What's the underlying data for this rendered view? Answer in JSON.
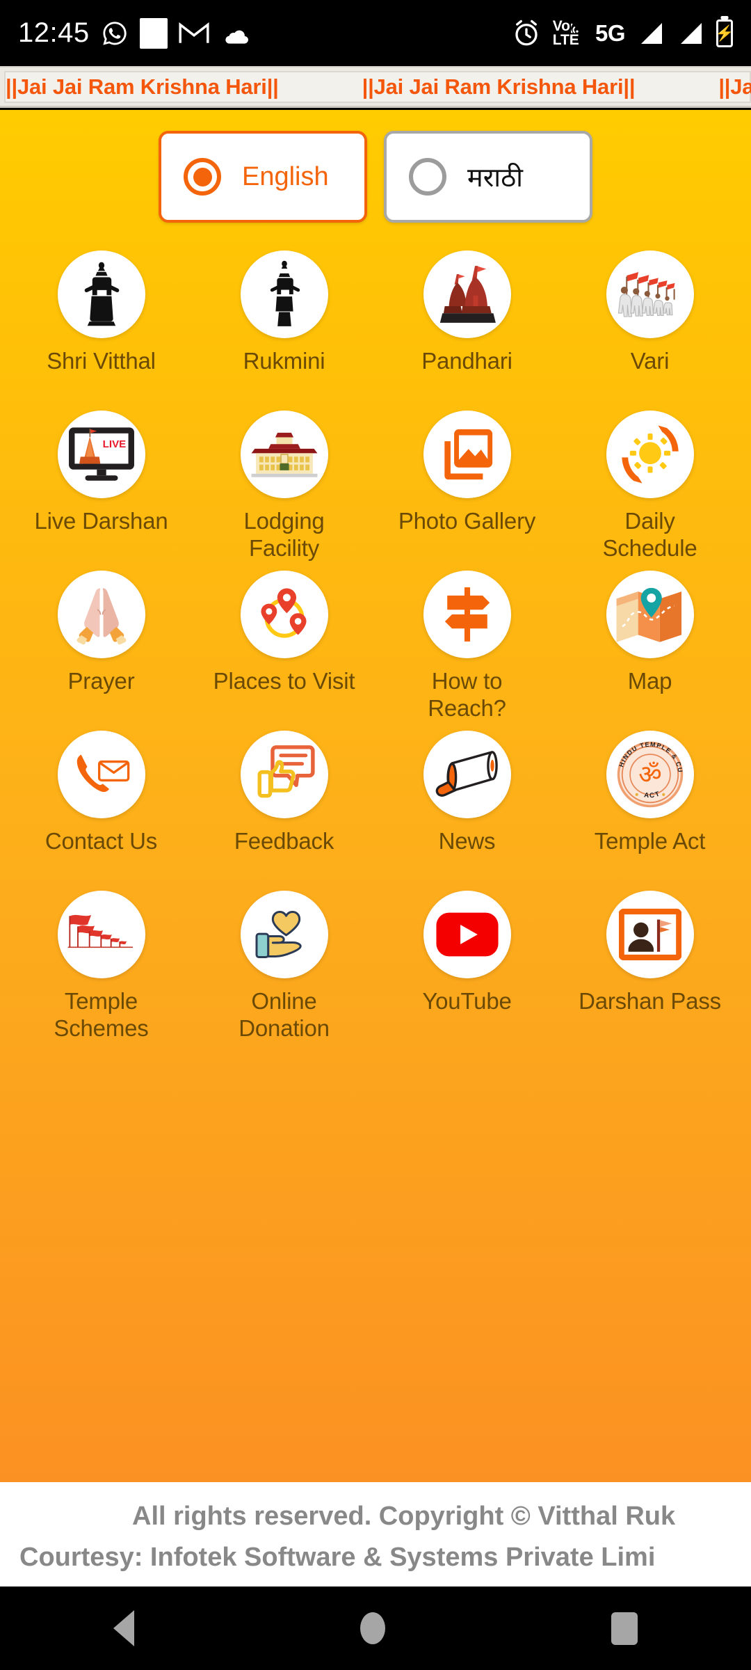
{
  "statusbar": {
    "time": "12:45",
    "left_icons": [
      "whatsapp-icon",
      "white-square-icon",
      "gmail-icon",
      "cloud-icon"
    ],
    "right_icons": [
      "alarm-icon",
      "volte-icon",
      "5g-icon",
      "signal-icon",
      "signal-icon",
      "battery-charging-icon"
    ],
    "volte_top": "Vo",
    "volte_bottom": "LTE",
    "network": "5G"
  },
  "marquee": {
    "text": "||Jai Jai Ram Krishna Hari||",
    "repeats": 4,
    "color": "#f4560c"
  },
  "language": {
    "selected": "English",
    "options": [
      {
        "label": "English",
        "selected": true
      },
      {
        "label": "मराठी",
        "selected": false
      }
    ]
  },
  "grid": {
    "items": [
      {
        "label": "Shri Vitthal",
        "icon": "vitthal-deity-icon"
      },
      {
        "label": "Rukmini",
        "icon": "rukmini-deity-icon"
      },
      {
        "label": "Pandhari",
        "icon": "temple-domes-icon"
      },
      {
        "label": "Vari",
        "icon": "pilgrims-flags-icon"
      },
      {
        "label": "Live Darshan",
        "icon": "live-monitor-icon"
      },
      {
        "label": "Lodging Facility",
        "icon": "lodging-building-icon"
      },
      {
        "label": "Photo Gallery",
        "icon": "photo-gallery-icon"
      },
      {
        "label": "Daily Schedule",
        "icon": "sun-schedule-icon"
      },
      {
        "label": "Prayer",
        "icon": "folded-hands-icon"
      },
      {
        "label": "Places to Visit",
        "icon": "map-pins-icon"
      },
      {
        "label": "How to Reach?",
        "icon": "signpost-icon"
      },
      {
        "label": "Map",
        "icon": "folded-map-icon"
      },
      {
        "label": "Contact Us",
        "icon": "phone-envelope-icon"
      },
      {
        "label": "Feedback",
        "icon": "thumbsup-chat-icon"
      },
      {
        "label": "News",
        "icon": "megaphone-icon"
      },
      {
        "label": "Temple Act",
        "icon": "om-seal-icon"
      },
      {
        "label": "Temple Schemes",
        "icon": "red-flags-icon"
      },
      {
        "label": "Online Donation",
        "icon": "hand-heart-icon"
      },
      {
        "label": "YouTube",
        "icon": "youtube-icon"
      },
      {
        "label": "Darshan Pass",
        "icon": "id-card-icon"
      }
    ]
  },
  "temple_act_seal": {
    "outer_text": "HINDU TEMPLE & CULTURAL CENTRE",
    "bottom_text": "ACT",
    "symbol": "ॐ"
  },
  "live_badge": "LIVE",
  "footer": {
    "line1": "All rights reserved. Copyright © Vitthal Ruk",
    "line2": "Courtesy: Infotek Software & Systems Private Limi"
  },
  "navbar": {
    "items": [
      "back-button",
      "home-button",
      "recents-button"
    ]
  },
  "colors": {
    "accent_orange": "#f4640a",
    "bg_top": "#ffcc00",
    "bg_bottom": "#fb9122",
    "label_text": "#6b4a06",
    "marquee_text": "#f4560c"
  }
}
